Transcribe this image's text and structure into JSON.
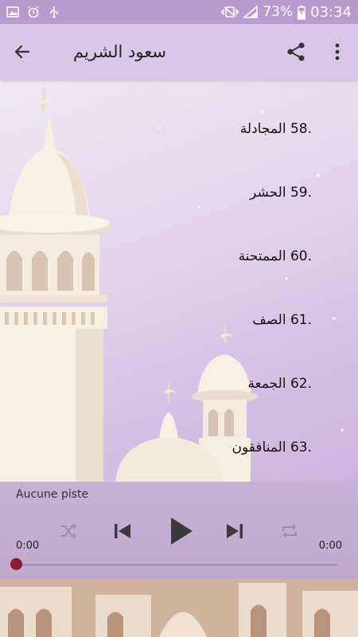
{
  "status_bar": {
    "battery_percent": "73%",
    "time": "03:34",
    "left_icons": [
      "image-icon",
      "alarm-icon",
      "usb-icon"
    ],
    "right_icons": [
      "vibrate-icon",
      "signal-icon",
      "battery-icon"
    ]
  },
  "app_bar": {
    "title": "سعود الشريم",
    "actions": [
      "share-icon",
      "more-vert-icon"
    ]
  },
  "tracks": [
    {
      "label": ".58 المجادلة"
    },
    {
      "label": ".59 الحشر"
    },
    {
      "label": ".60 الممتحنة"
    },
    {
      "label": ".61 الصف"
    },
    {
      "label": ".62 الجمعة"
    },
    {
      "label": ".63 المنافقون"
    }
  ],
  "player": {
    "now_playing": "Aucune piste",
    "elapsed": "0:00",
    "duration": "0:00",
    "progress": 0
  },
  "colors": {
    "status_bar": "#b79bcf",
    "app_bar": "#d8c7e6",
    "player_bg": "#c7b2d6",
    "seek_thumb": "#8a1f33"
  }
}
